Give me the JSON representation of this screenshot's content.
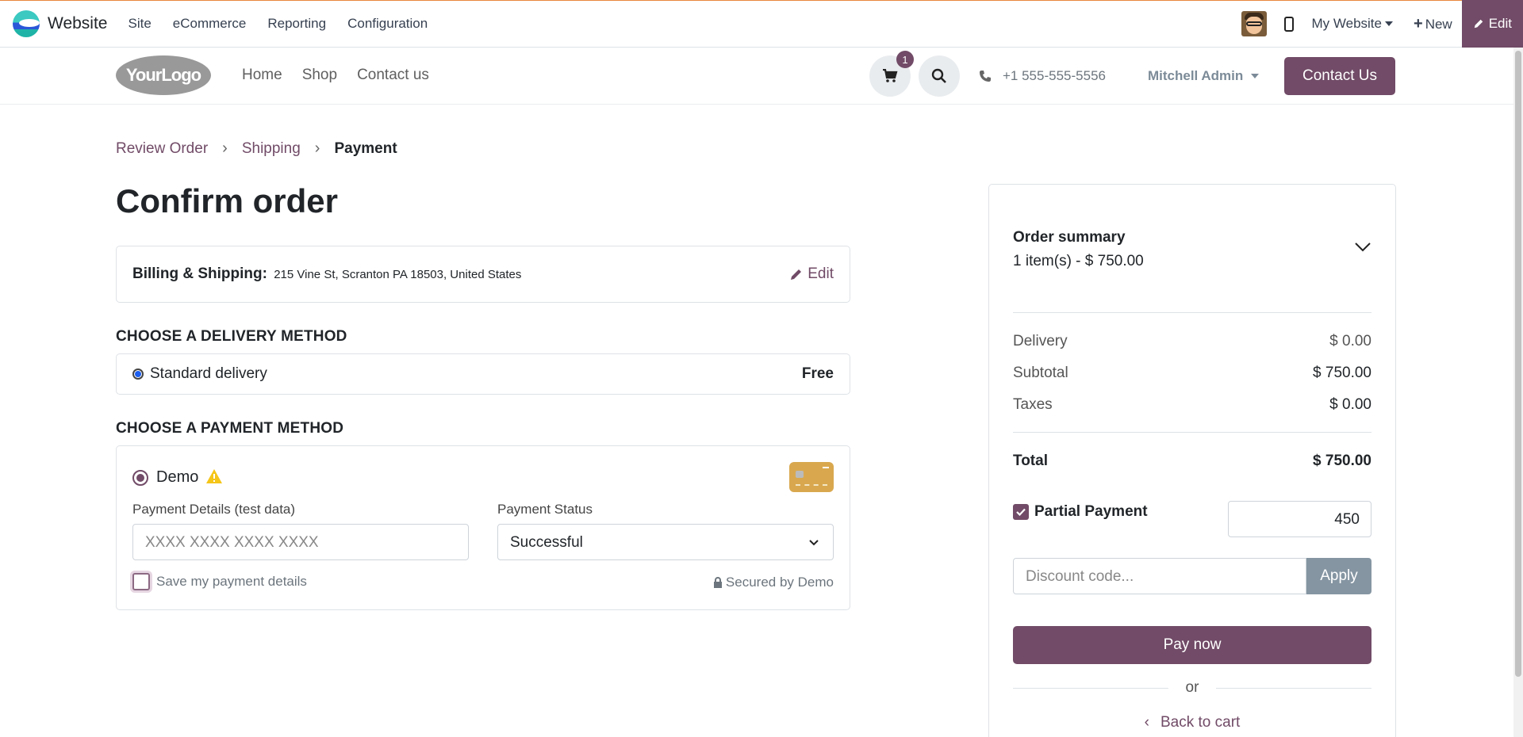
{
  "odoo_bar": {
    "app_name": "Website",
    "menu": [
      "Site",
      "eCommerce",
      "Reporting",
      "Configuration"
    ],
    "website_selector": "My Website",
    "new_label": "New",
    "edit_label": "Edit"
  },
  "site_header": {
    "logo_text": "YourLogo",
    "nav": [
      "Home",
      "Shop",
      "Contact us"
    ],
    "cart_count": "1",
    "phone": "+1 555-555-5556",
    "user": "Mitchell Admin",
    "contact_button": "Contact Us"
  },
  "breadcrumb": {
    "step1": "Review Order",
    "step2": "Shipping",
    "step3": "Payment"
  },
  "page_title": "Confirm order",
  "billing": {
    "label": "Billing & Shipping:",
    "address": "215 Vine St, Scranton PA 18503, United States",
    "edit_label": "Edit"
  },
  "delivery": {
    "heading": "CHOOSE A DELIVERY METHOD",
    "method": "Standard delivery",
    "price": "Free"
  },
  "payment": {
    "heading": "CHOOSE A PAYMENT METHOD",
    "provider": "Demo",
    "details_label": "Payment Details (test data)",
    "details_placeholder": "XXXX XXXX XXXX XXXX",
    "status_label": "Payment Status",
    "status_value": "Successful",
    "save_label": "Save my payment details",
    "secured_label": "Secured by Demo"
  },
  "summary": {
    "heading": "Order summary",
    "items": "1 item(s) -  $ 750.00",
    "delivery_label": "Delivery",
    "delivery_value": "$ 0.00",
    "subtotal_label": "Subtotal",
    "subtotal_value": "$ 750.00",
    "taxes_label": "Taxes",
    "taxes_value": "$ 0.00",
    "total_label": "Total",
    "total_value": "$ 750.00",
    "partial_label": "Partial Payment",
    "partial_value": "450",
    "discount_placeholder": "Discount code...",
    "apply_label": "Apply",
    "pay_label": "Pay now",
    "or_label": "or",
    "back_label": "Back to cart"
  },
  "colors": {
    "brand": "#714b67",
    "accent_orange": "#e8863c"
  }
}
